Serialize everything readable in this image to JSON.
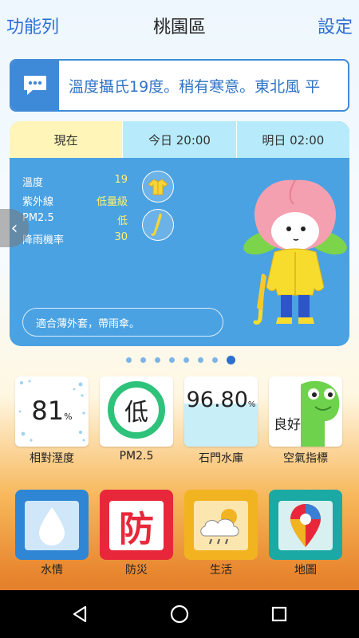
{
  "header": {
    "menu_label": "功能列",
    "title": "桃園區",
    "settings_label": "設定"
  },
  "banner": {
    "message": "溫度攝氏19度。稍有寒意。東北風 平"
  },
  "weather": {
    "tabs": [
      {
        "label": "現在"
      },
      {
        "label": "今日 20:00"
      },
      {
        "label": "明日 02:00"
      }
    ],
    "stats": [
      {
        "label": "溫度",
        "value": "19"
      },
      {
        "label": "紫外線",
        "value": "低量級"
      },
      {
        "label": "PM2.5",
        "value": "低"
      },
      {
        "label": "降雨機率",
        "value": "30"
      }
    ],
    "advice": "適合薄外套，帶雨傘。"
  },
  "pager": {
    "total": 8,
    "active_index": 7
  },
  "tiles": [
    {
      "value": "81",
      "unit": "%",
      "label": "相對溼度"
    },
    {
      "value": "低",
      "label": "PM2.5"
    },
    {
      "value": "96.80",
      "unit": "%",
      "label": "石門水庫"
    },
    {
      "value": "良好",
      "label": "空氣指標"
    }
  ],
  "features": [
    {
      "label": "水情",
      "icon": "water-drop-icon",
      "color": "#2e86d4"
    },
    {
      "label": "防災",
      "icon": "disaster-prevention-icon",
      "glyph": "防",
      "color": "#e8283a"
    },
    {
      "label": "生活",
      "icon": "weather-cloud-icon",
      "color": "#f2b321"
    },
    {
      "label": "地圖",
      "icon": "map-pin-icon",
      "color": "#1ba9a4"
    }
  ],
  "colors": {
    "accent": "#2f6fd6",
    "card_blue": "#4aa2e2",
    "highlight_yellow": "#fff16e"
  }
}
